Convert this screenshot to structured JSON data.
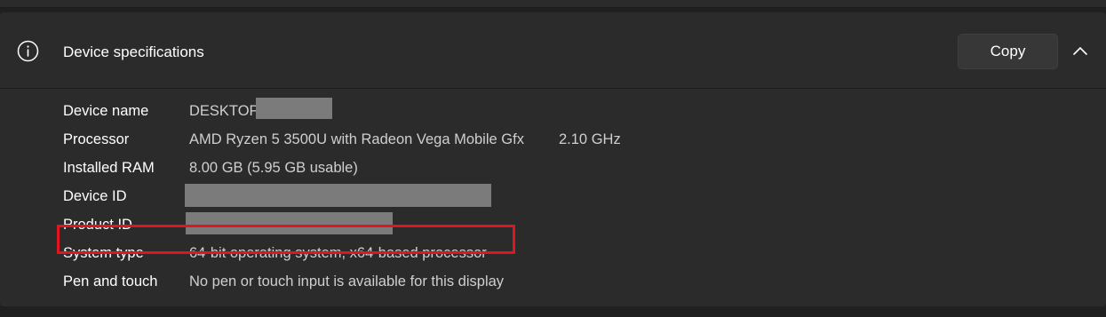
{
  "header": {
    "title": "Device specifications",
    "copy_label": "Copy"
  },
  "specs": [
    {
      "label": "Device name",
      "value": "DESKTOP-"
    },
    {
      "label": "Processor",
      "value": "AMD Ryzen 5 3500U with Radeon Vega Mobile Gfx",
      "value2": "2.10 GHz"
    },
    {
      "label": "Installed RAM",
      "value": "8.00 GB (5.95 GB usable)"
    },
    {
      "label": "Device ID",
      "value": ""
    },
    {
      "label": "Product ID",
      "value": ""
    },
    {
      "label": "System type",
      "value": "64-bit operating system, x64-based processor"
    },
    {
      "label": "Pen and touch",
      "value": "No pen or touch input is available for this display"
    }
  ],
  "icons": {
    "info": "info-circle-icon",
    "collapse": "chevron-up-icon"
  },
  "colors": {
    "background": "#202020",
    "panel": "#2b2b2b",
    "highlight": "#e0151f",
    "redaction": "#7b7b7b"
  }
}
